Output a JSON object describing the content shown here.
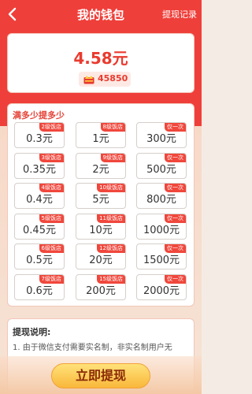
{
  "header": {
    "title": "我的钱包",
    "history_label": "提现记录"
  },
  "balance": {
    "amount": "4.58元",
    "coins": "45850"
  },
  "options": {
    "title": "满多少提多少",
    "items": [
      {
        "amount": "0.3元",
        "tag": "2级饭店"
      },
      {
        "amount": "1元",
        "tag": "8级饭店"
      },
      {
        "amount": "300元",
        "tag": "仅一次"
      },
      {
        "amount": "0.35元",
        "tag": "3级饭店"
      },
      {
        "amount": "2元",
        "tag": "9级饭店"
      },
      {
        "amount": "500元",
        "tag": "仅一次"
      },
      {
        "amount": "0.4元",
        "tag": "4级饭店"
      },
      {
        "amount": "5元",
        "tag": "10级饭店"
      },
      {
        "amount": "800元",
        "tag": "仅一次"
      },
      {
        "amount": "0.45元",
        "tag": "5级饭店"
      },
      {
        "amount": "10元",
        "tag": "11级饭店"
      },
      {
        "amount": "1000元",
        "tag": "仅一次"
      },
      {
        "amount": "0.5元",
        "tag": "6级饭店"
      },
      {
        "amount": "20元",
        "tag": "12级饭店"
      },
      {
        "amount": "1500元",
        "tag": "仅一次"
      },
      {
        "amount": "0.6元",
        "tag": "7级饭店"
      },
      {
        "amount": "200元",
        "tag": "15级饭店"
      },
      {
        "amount": "2000元",
        "tag": "仅一次"
      }
    ]
  },
  "notes": {
    "title": "提现说明:",
    "line1": "1. 由于微信支付需要实名制，非实名制用户无"
  },
  "actions": {
    "withdraw_label": "立即提现"
  },
  "colors": {
    "header_red": "#ef3f3a",
    "accent_red": "#ea3b2f",
    "button_yellow": "#f9b73a"
  },
  "icons": {
    "back": "chevron-left-icon",
    "coin": "crown-coin-icon"
  }
}
